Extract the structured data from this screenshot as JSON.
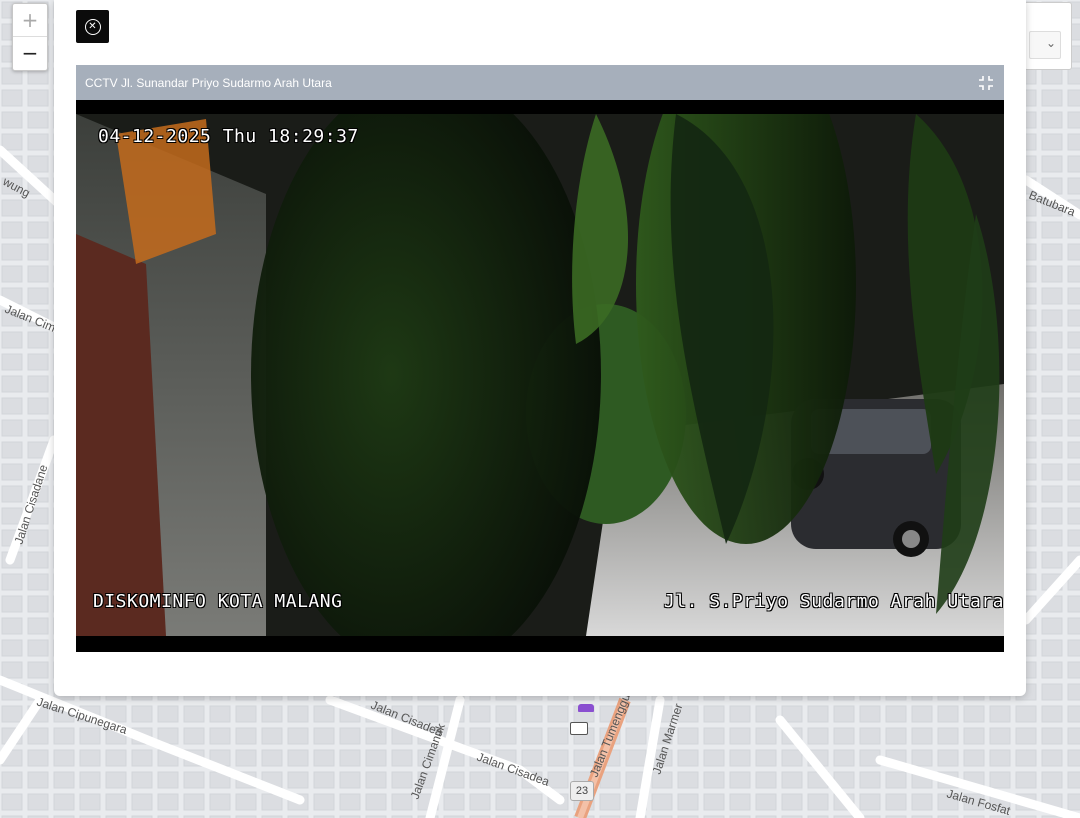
{
  "map": {
    "zoom_in": "+",
    "zoom_out": "−",
    "streets": [
      "Jalan Cipunegara",
      "Jalan Cisadea",
      "Jalan Cisadea",
      "Jalan Cimanuk",
      "Jalan Tumenggu",
      "Jalan Marmer",
      "Jalan Fosfat",
      "Jalan Cisadane",
      "Jalan Cim",
      "Batubara",
      "wung"
    ],
    "route_shield": "23"
  },
  "modal": {
    "close_icon": "close-circle-icon",
    "panel_title": "CCTV Jl. Sunandar Priyo Sudarmo Arah Utara",
    "expand_icon": "compress-icon",
    "video": {
      "timestamp": "04-12-2025 Thu 18:29:37",
      "source_overlay": "DISKOMINFO KOTA MALANG",
      "location_overlay": "Jl. S.Priyo Sudarmo Arah Utara"
    }
  },
  "colors": {
    "panel_header": "#a6afbb",
    "modal_bg": "#ffffff",
    "map_bg": "#e9ebee",
    "highway": "#e9a27f"
  }
}
